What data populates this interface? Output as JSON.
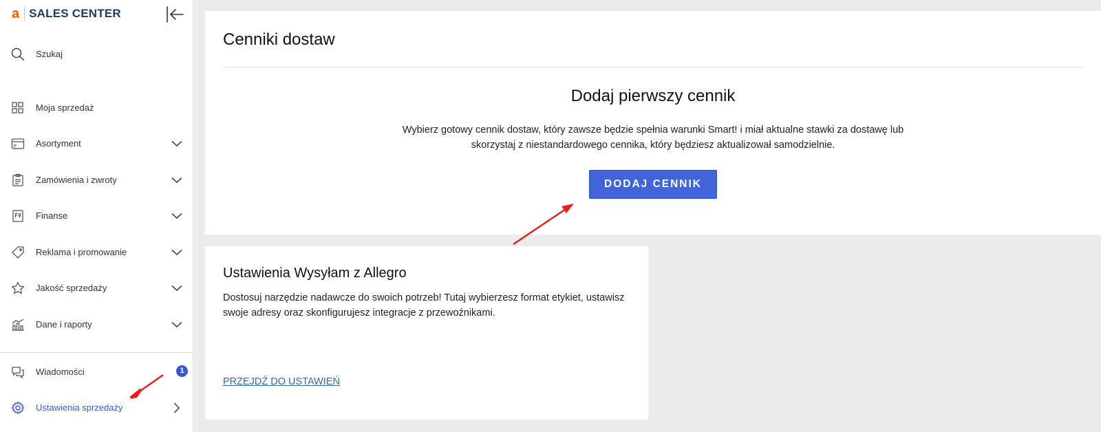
{
  "logo": {
    "mark": "a",
    "text": "SALES CENTER"
  },
  "sidebar": {
    "search_label": "Szukaj",
    "items": [
      {
        "label": "Moja sprzedaż",
        "icon": "grid-icon",
        "has_chevron": false
      },
      {
        "label": "Asortyment",
        "icon": "inventory-icon",
        "has_chevron": true
      },
      {
        "label": "Zamówienia i zwroty",
        "icon": "clipboard-icon",
        "has_chevron": true
      },
      {
        "label": "Finanse",
        "icon": "invoice-icon",
        "has_chevron": true
      },
      {
        "label": "Reklama i promowanie",
        "icon": "tag-icon",
        "has_chevron": true
      },
      {
        "label": "Jakość sprzedaży",
        "icon": "star-icon",
        "has_chevron": true
      },
      {
        "label": "Dane i raporty",
        "icon": "chart-icon",
        "has_chevron": true
      }
    ],
    "messages": {
      "label": "Wiadomości",
      "badge": "1"
    },
    "sales_settings": {
      "label": "Ustawienia sprzedaży"
    }
  },
  "main": {
    "title": "Cenniki dostaw",
    "empty_state": {
      "title": "Dodaj pierwszy cennik",
      "line1": "Wybierz gotowy cennik dostaw, który zawsze będzie spełnia warunki Smart! i miał aktualne stawki za dostawę lub",
      "line2": "skorzystaj z niestandardowego cennika, który będziesz aktualizował samodzielnie.",
      "button": "DODAJ CENNIK"
    },
    "shipping_settings": {
      "title": "Ustawienia Wysyłam z Allegro",
      "desc": "Dostosuj narzędzie nadawcze do swoich potrzeb! Tutaj wybierzesz format etykiet, ustawisz swoje adresy oraz skonfigurujesz integracje z przewoźnikami.",
      "link": "PRZEJDŹ DO USTAWIEŃ"
    }
  },
  "colors": {
    "accent": "#3a59cf",
    "button": "#4164d8",
    "brand": "#ff5a00",
    "annotation": "#e8201c"
  }
}
